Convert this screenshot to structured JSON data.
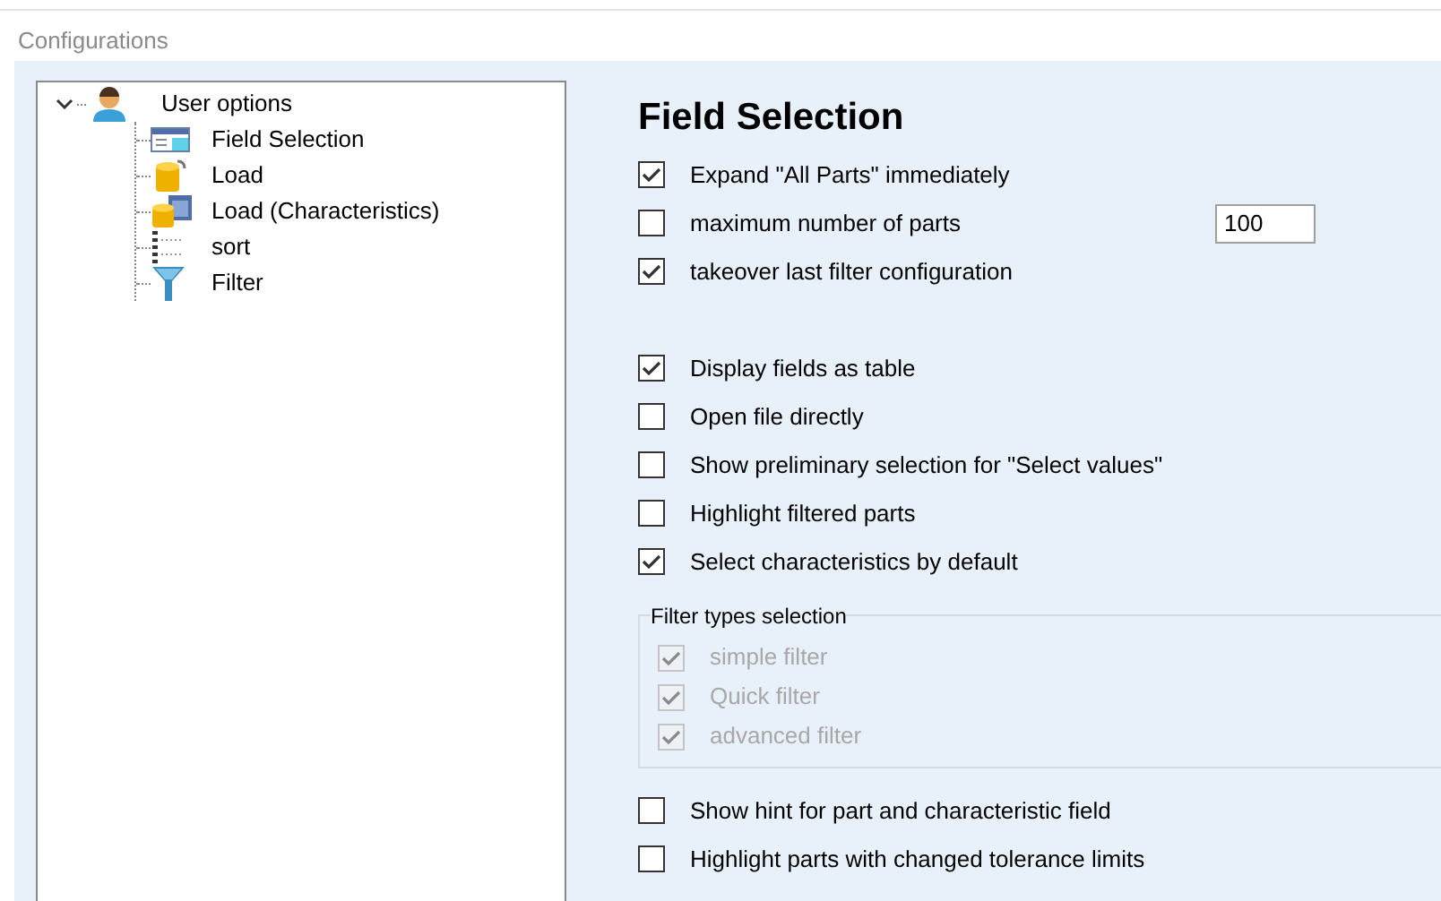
{
  "header": {
    "title": "Configurations"
  },
  "tree": {
    "label": "User options",
    "expanded": true,
    "children": [
      {
        "label": "Field Selection",
        "kind": "table"
      },
      {
        "label": "Load",
        "kind": "database"
      },
      {
        "label": "Load (Characteristics)",
        "kind": "database-table"
      },
      {
        "label": "sort",
        "kind": "sort"
      },
      {
        "label": "Filter",
        "kind": "filter"
      }
    ]
  },
  "page": {
    "title": "Field Selection",
    "sections": [
      {
        "options": [
          {
            "label": "Expand \"All Parts\" immediately",
            "checked": true
          },
          {
            "label": "maximum number of parts",
            "checked": false,
            "value": "100"
          },
          {
            "label": "takeover last filter configuration",
            "checked": true
          }
        ]
      },
      {
        "options": [
          {
            "label": "Display fields as table",
            "checked": true
          },
          {
            "label": "Open file directly",
            "checked": false
          },
          {
            "label": "Show preliminary selection for \"Select values\"",
            "checked": false
          },
          {
            "label": "Highlight filtered parts",
            "checked": false
          },
          {
            "label": "Select characteristics by default",
            "checked": true
          }
        ]
      },
      {
        "group_title": "Filter types selection",
        "options": [
          {
            "label": "simple filter",
            "checked": true,
            "disabled": true
          },
          {
            "label": "Quick filter",
            "checked": true,
            "disabled": true
          },
          {
            "label": "advanced filter",
            "checked": true,
            "disabled": true
          }
        ]
      },
      {
        "options": [
          {
            "label": "Show hint for part and characteristic field",
            "checked": false
          },
          {
            "label": "Highlight parts with changed tolerance limits",
            "checked": false
          }
        ]
      }
    ]
  }
}
